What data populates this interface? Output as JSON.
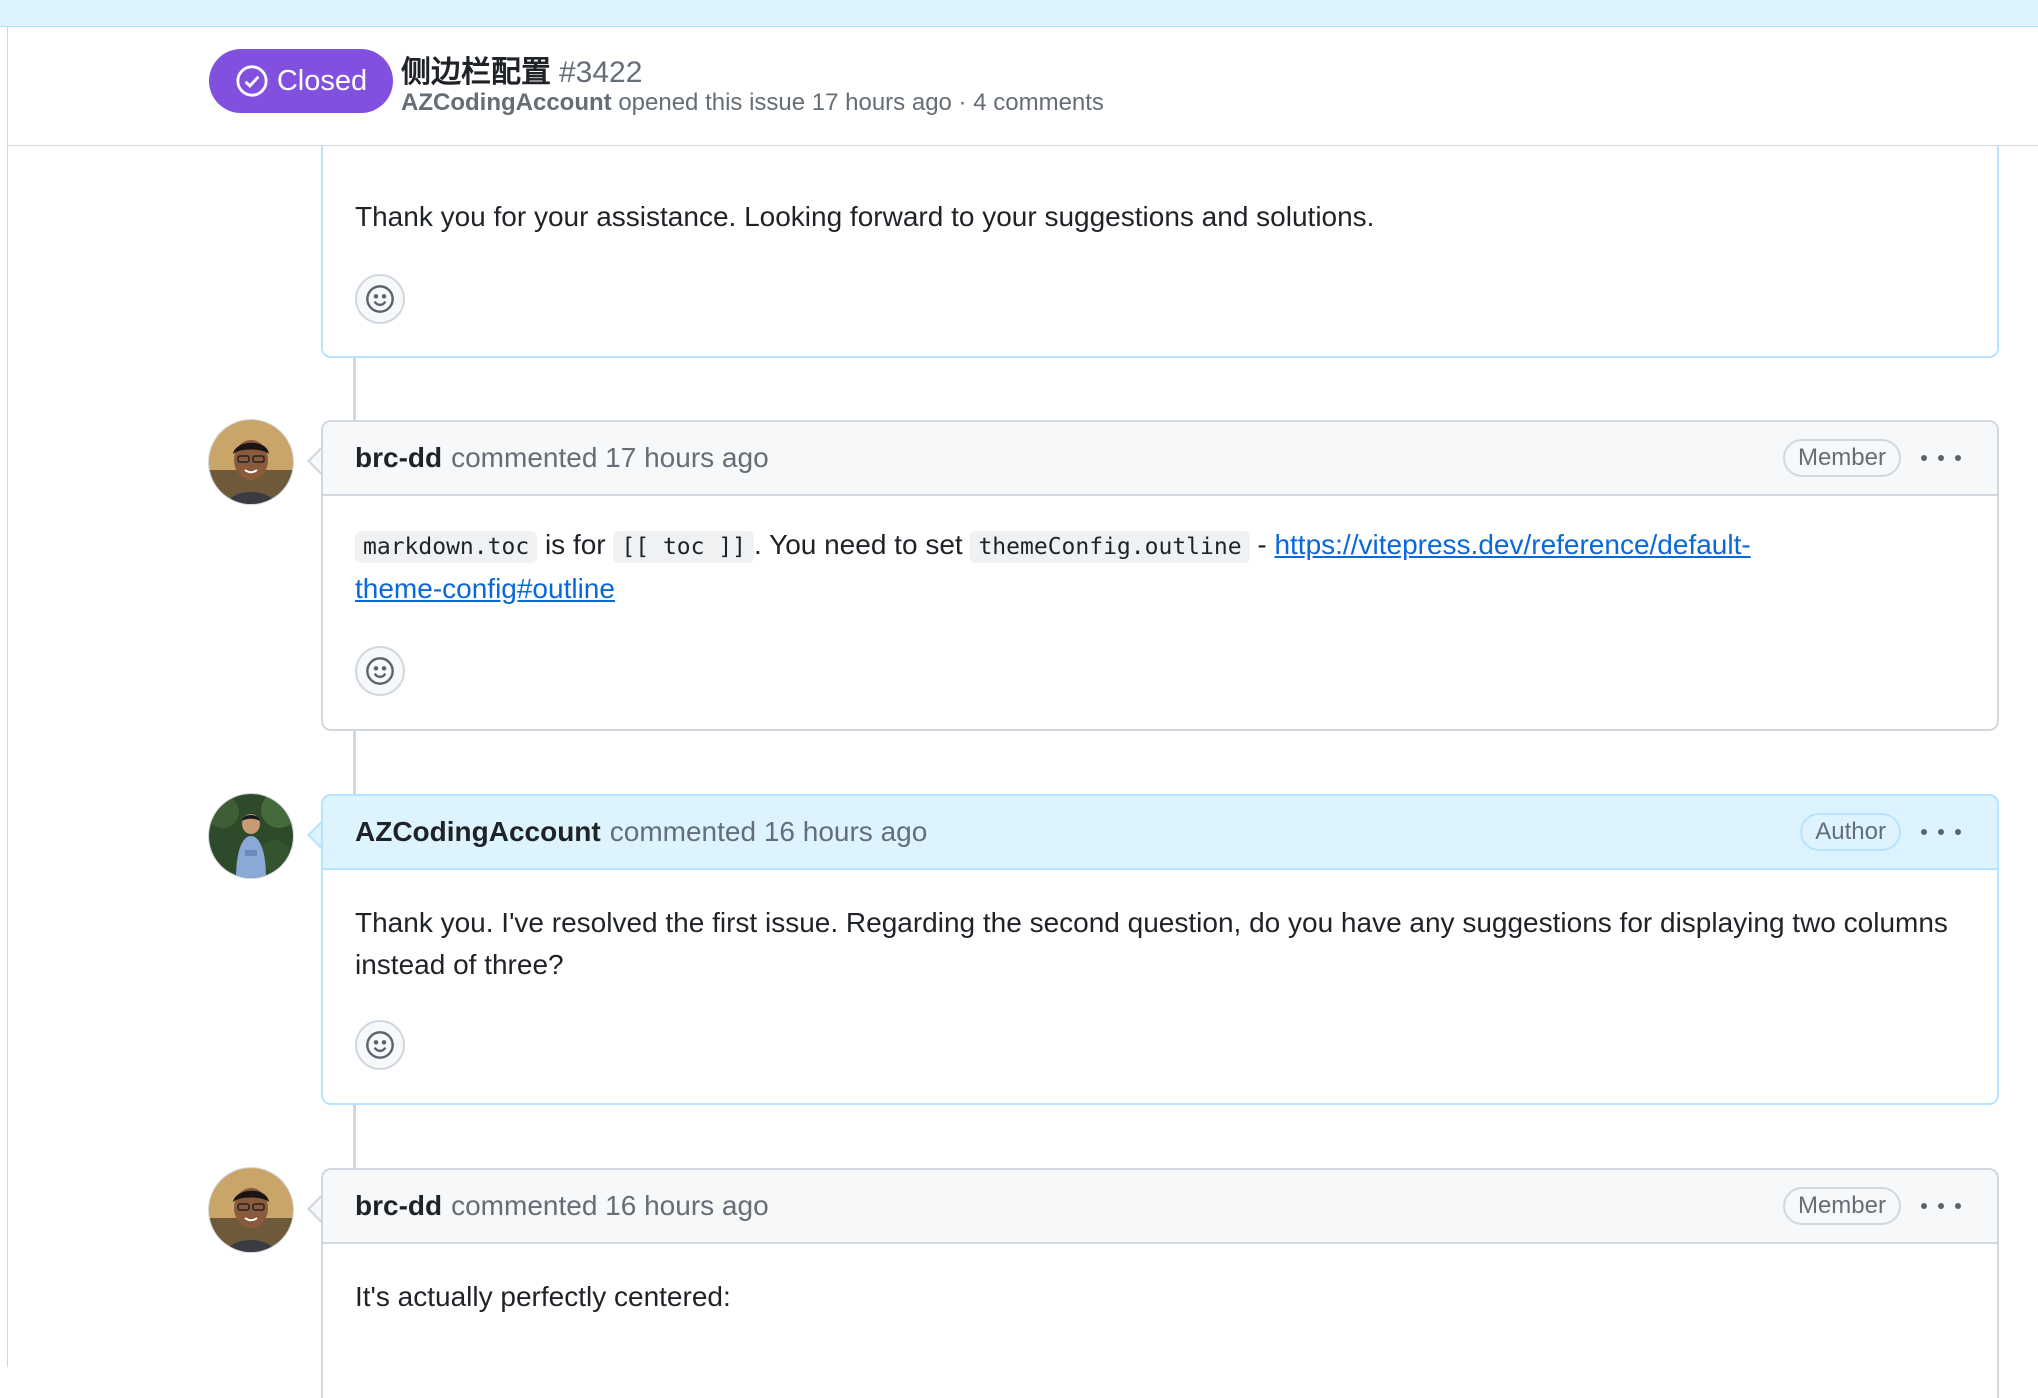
{
  "issue": {
    "state": "Closed",
    "title": "侧边栏配置",
    "number": "#3422",
    "author": "AZCodingAccount",
    "meta": "opened this issue 17 hours ago · 4 comments"
  },
  "comments": [
    {
      "body": "Thank you for your assistance. Looking forward to your suggestions and solutions."
    },
    {
      "login": "brc-dd",
      "action": "commented 17 hours ago",
      "role": "Member",
      "body": {
        "code1": "markdown.toc",
        "text1": " is for ",
        "code2": "[[ toc ]]",
        "text2": ". You need to set ",
        "code3": "themeConfig.outline",
        "text3": " - ",
        "link": "https://vitepress.dev/reference/default-theme-config#outline"
      }
    },
    {
      "login": "AZCodingAccount",
      "action": "commented 16 hours ago",
      "role": "Author",
      "body": "Thank you. I've resolved the first issue. Regarding the second question, do you have any suggestions for displaying two columns instead of three?"
    },
    {
      "login": "brc-dd",
      "action": "commented 16 hours ago",
      "role": "Member",
      "body": "It's actually perfectly centered:"
    }
  ],
  "icons": {
    "state": "check-circle-icon",
    "reaction": "smiley-icon",
    "menu": "kebab-horizontal-icon"
  },
  "colors": {
    "closed_badge": "#8250df",
    "link": "#0969da",
    "author_highlight": "#ddf4ff",
    "border": "#d0d7de"
  }
}
